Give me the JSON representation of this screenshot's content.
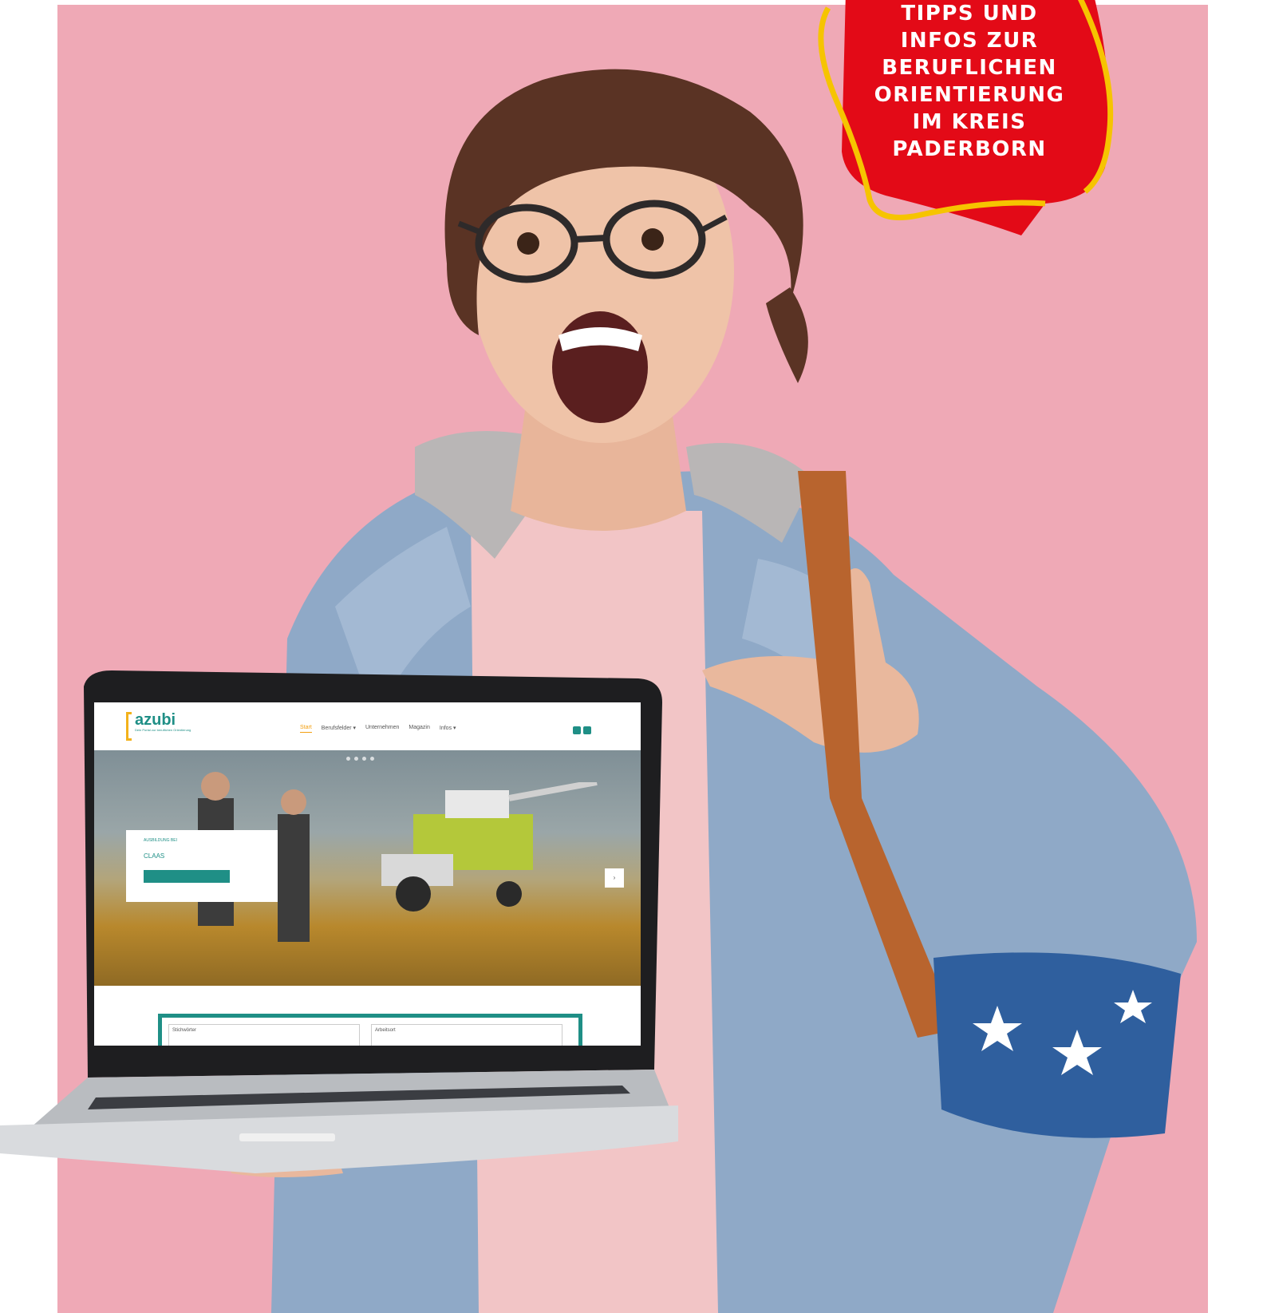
{
  "badge": {
    "lines": [
      "TIPPS UND",
      "INFOS ZUR",
      "BERUFLICHEN",
      "ORIENTIERUNG",
      "IM KREIS",
      "PADERBORN"
    ],
    "color_fill": "#e30a17",
    "color_outline": "#f6c400"
  },
  "laptop_site": {
    "logo": {
      "word": "azubi",
      "subtitle": "Dein Portal zur beruflichen Orientierung"
    },
    "nav": [
      "Start",
      "Berufsfelder ▾",
      "Unternehmen",
      "Magazin",
      "Infos ▾"
    ],
    "hero": {
      "kicker": "AUSBILDUNG BEI",
      "brand": "CLAAS",
      "next_icon": "›"
    },
    "search": {
      "field1_label": "Stichwörter",
      "field2_label": "Arbeitsort"
    },
    "accent_color": "#1f8f86",
    "highlight_color": "#f3a012"
  },
  "background_color": "#efa9b6"
}
